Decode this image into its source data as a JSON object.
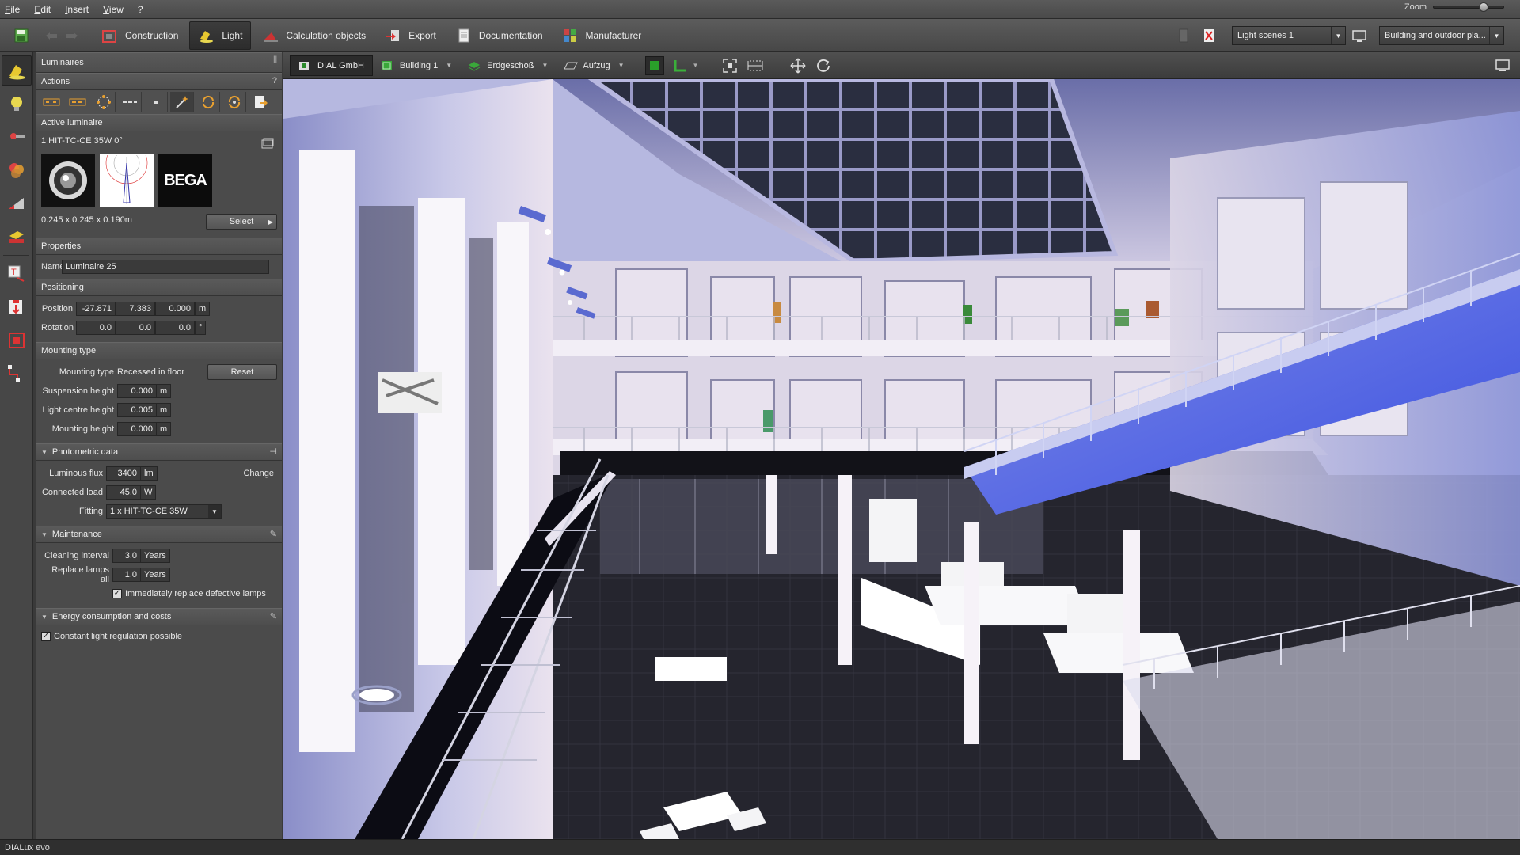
{
  "menu": {
    "items": [
      "File",
      "Edit",
      "Insert",
      "View",
      "?"
    ]
  },
  "zoom": {
    "label": "Zoom",
    "value_fraction": 0.7
  },
  "toolbar": {
    "tabs": [
      {
        "label": "Construction",
        "icon": "construction-icon"
      },
      {
        "label": "Light",
        "icon": "light-icon",
        "active": true
      },
      {
        "label": "Calculation objects",
        "icon": "calculation-icon"
      },
      {
        "label": "Export",
        "icon": "export-icon"
      },
      {
        "label": "Documentation",
        "icon": "documentation-icon"
      },
      {
        "label": "Manufacturer",
        "icon": "manufacturer-icon"
      }
    ],
    "light_scenes": "Light scenes 1",
    "view_select": "Building and outdoor pla..."
  },
  "panel": {
    "title": "Luminaires",
    "actions_title": "Actions",
    "active_luminaire_title": "Active luminaire",
    "luminaire_name": "1 HIT-TC-CE 35W 0°",
    "brand": "BEGA",
    "dimensions": "0.245 x 0.245 x 0.190m",
    "select_label": "Select",
    "properties_title": "Properties",
    "name_label": "Name",
    "name_value": "Luminaire 25",
    "positioning_title": "Positioning",
    "position_label": "Position",
    "position": [
      "-27.871",
      "7.383",
      "0.000"
    ],
    "position_unit": "m",
    "rotation_label": "Rotation",
    "rotation": [
      "0.0",
      "0.0",
      "0.0"
    ],
    "rotation_unit": "°",
    "mounting_title": "Mounting type",
    "mounting_type_label": "Mounting type",
    "mounting_type_value": "Recessed in floor",
    "reset_label": "Reset",
    "suspension_label": "Suspension height",
    "suspension_value": "0.000",
    "light_centre_label": "Light centre height",
    "light_centre_value": "0.005",
    "mounting_height_label": "Mounting height",
    "mounting_height_value": "0.000",
    "height_unit": "m",
    "photometric_title": "Photometric data",
    "flux_label": "Luminous flux",
    "flux_value": "3400",
    "flux_unit": "lm",
    "change_label": "Change",
    "load_label": "Connected load",
    "load_value": "45.0",
    "load_unit": "W",
    "fitting_label": "Fitting",
    "fitting_value": "1 x HIT-TC-CE  35W",
    "maintenance_title": "Maintenance",
    "cleaning_label": "Cleaning interval",
    "cleaning_value": "3.0",
    "replace_label": "Replace lamps all",
    "replace_value": "1.0",
    "years_unit": "Years",
    "defective_label": "Immediately replace defective lamps",
    "energy_title": "Energy consumption and costs",
    "constant_label": "Constant light regulation possible"
  },
  "viewport": {
    "breadcrumbs": [
      "DIAL GmbH",
      "Building 1",
      "Erdgeschoß",
      "Aufzug"
    ]
  },
  "status": {
    "app_name": "DIALux evo"
  }
}
